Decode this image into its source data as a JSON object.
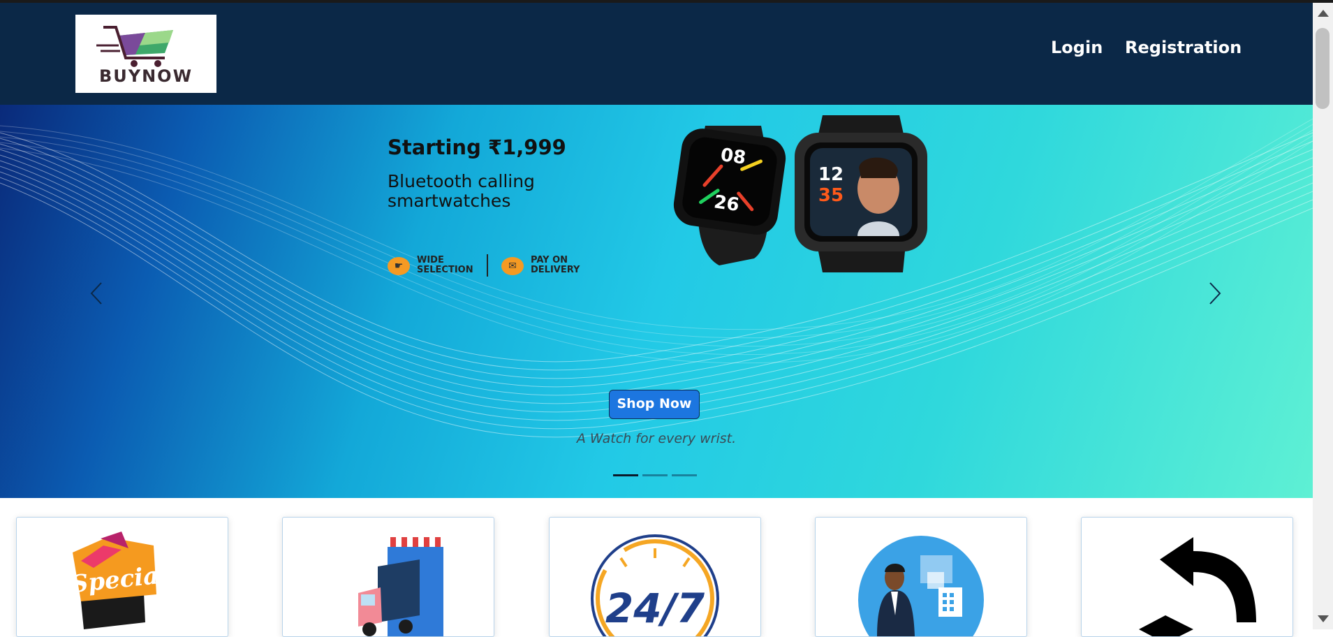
{
  "header": {
    "logo_text": "BUYNOW",
    "nav": {
      "login": "Login",
      "registration": "Registration"
    }
  },
  "carousel": {
    "promo": {
      "title": "Starting ₹1,999",
      "subtitle_line1": "Bluetooth calling",
      "subtitle_line2": "smartwatches",
      "features": [
        {
          "text": "WIDE\nSELECTION",
          "icon": "hand-pointer-icon"
        },
        {
          "text": "PAY ON\nDELIVERY",
          "icon": "cash-icon"
        }
      ],
      "watch1_hour": "08",
      "watch1_min": "26",
      "watch2_hour": "12",
      "watch2_min": "35"
    },
    "button_label": "Shop Now",
    "caption": "A Watch for every wrist.",
    "active_slide": 0,
    "slide_count": 3
  },
  "cards": [
    {
      "icon": "special-offer-icon",
      "text": "Special"
    },
    {
      "icon": "delivery-truck-icon"
    },
    {
      "icon": "support-24-7-icon",
      "text": "24/7"
    },
    {
      "icon": "customer-service-icon"
    },
    {
      "icon": "return-arrow-icon"
    }
  ],
  "colors": {
    "navbar": "#0b2847",
    "button": "#1c76e0",
    "card_border": "#b7d3ea"
  }
}
